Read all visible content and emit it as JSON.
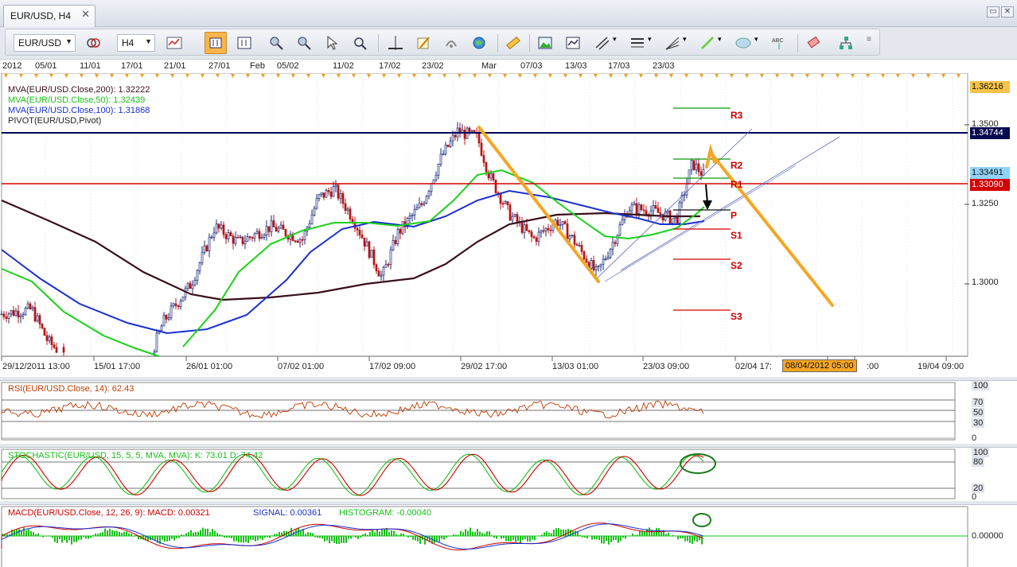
{
  "tab": {
    "title": "EUR/USD, H4",
    "close": "✕"
  },
  "window": {
    "restore": "▭",
    "close": "✕"
  },
  "toolbar": {
    "instrument": "EUR/USD",
    "timeframe": "H4"
  },
  "top_dates": [
    "2012",
    "05/01",
    "11/01",
    "17/01",
    "21/01",
    "27/01",
    "Feb",
    "05/02",
    "11/02",
    "17/02",
    "23/02",
    "Mar",
    "07/03",
    "13/03",
    "17/03",
    "23/03"
  ],
  "legend": {
    "mva200": "MVA(EUR/USD.Close,200): 1.32222",
    "mva50": "MVA(EUR/USD.Close,50): 1.32439",
    "mva100": "MVA(EUR/USD.Close,100): 1.31868",
    "pivot": "PIVOT(EUR/USD,Pivot)"
  },
  "pivot_labels": {
    "r3": "R3",
    "r2": "R2",
    "r1": "R1",
    "p": "P",
    "s1": "S1",
    "s2": "S2",
    "s3": "S3"
  },
  "price_axis": {
    "top": "1.36216",
    "blue_line": "1.34744",
    "last": "1.33491",
    "red_line": "1.33090",
    "t1": "1.3500",
    "t2": "1.3250",
    "t3": "1.3000"
  },
  "x_axis": [
    "29/12/2011 13:00",
    "15/01 17:00",
    "26/01 01:00",
    "07/02 01:00",
    "17/02 09:00",
    "29/02 17:00",
    "13/03 01:00",
    "23/03 09:00",
    "02/04 17:",
    "08/04/2012 05:00",
    ":00",
    "19/04 09:00"
  ],
  "rsi": {
    "label": "RSI(EUR/USD.Close, 14): 62.43",
    "scale": [
      "100",
      "70",
      "50",
      "30",
      "0"
    ]
  },
  "stoch": {
    "label": "STOCHASTIC(EUR/USD, 15, 5, 5, MVA, MVA): K: 73.01   D: 74.42",
    "scale": [
      "100",
      "80",
      "20",
      "0"
    ]
  },
  "macd": {
    "label_main": "MACD(EUR/USD.Close, 12, 26, 9):  MACD: 0.00321",
    "label_signal": "SIGNAL: 0.00361",
    "label_hist": "HISTOGRAM: -0.00040",
    "scale": "0.00000"
  },
  "colors": {
    "mva200": "#3b0f1a",
    "mva50": "#19d219",
    "mva100": "#1a2fd0",
    "pivot_red": "#d40000",
    "pivot_green": "#0a9a0a",
    "annotation": "#f6a623",
    "blue_line": "#00005c"
  }
}
